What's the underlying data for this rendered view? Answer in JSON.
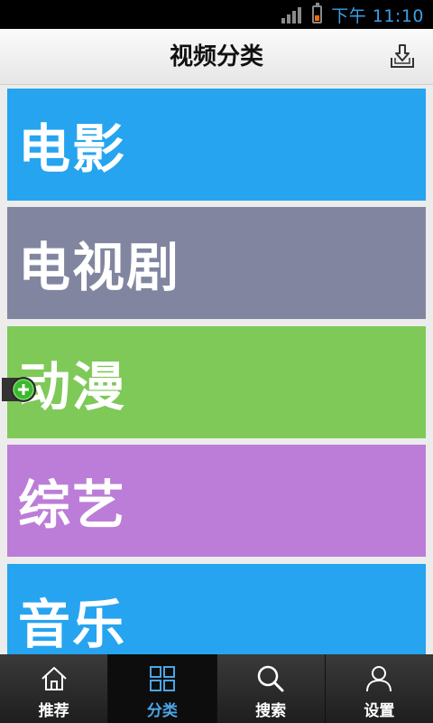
{
  "status_bar": {
    "time": "下午 11:10"
  },
  "header": {
    "title": "视频分类"
  },
  "categories": [
    {
      "label": "电影",
      "color": "#27a4ef"
    },
    {
      "label": "电视剧",
      "color": "#8185a0"
    },
    {
      "label": "动漫",
      "color": "#7ec958"
    },
    {
      "label": "综艺",
      "color": "#bc7dd9"
    },
    {
      "label": "音乐",
      "color": "#27a4ef"
    }
  ],
  "tab_bar": {
    "tabs": [
      {
        "label": "推荐",
        "icon": "home-icon",
        "active": false
      },
      {
        "label": "分类",
        "icon": "grid-icon",
        "active": true
      },
      {
        "label": "搜索",
        "icon": "search-icon",
        "active": false
      },
      {
        "label": "设置",
        "icon": "user-icon",
        "active": false
      }
    ],
    "active_color": "#4ba6e6"
  }
}
